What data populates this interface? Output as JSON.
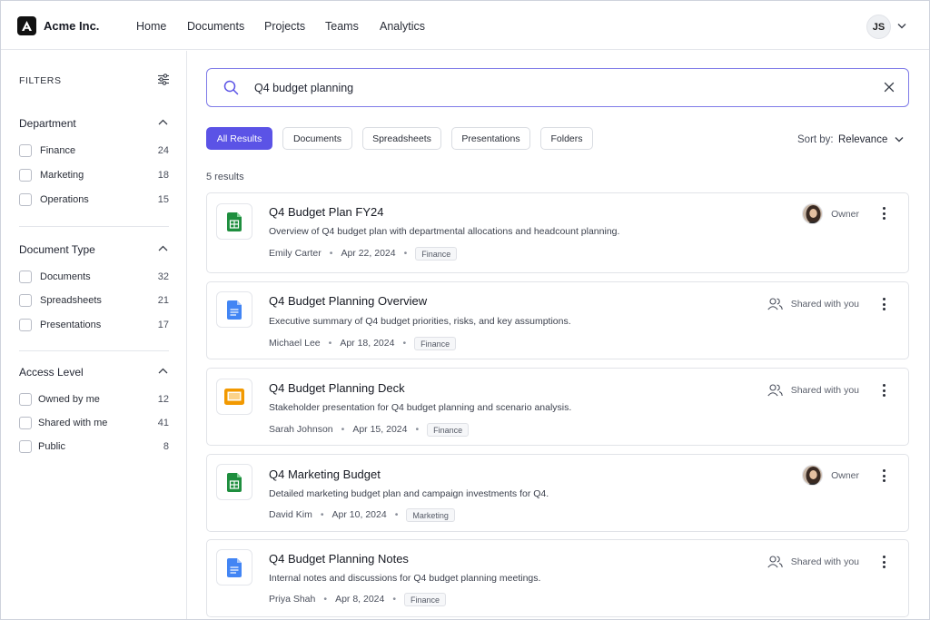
{
  "app": {
    "brand": "Acme Inc.",
    "nav": [
      "Home",
      "Documents",
      "Projects",
      "Teams",
      "Analytics"
    ],
    "user_initials": "JS"
  },
  "sidebar": {
    "title": "FILTERS",
    "sections": [
      {
        "title": "Department",
        "items": [
          {
            "label": "Finance",
            "count": "24"
          },
          {
            "label": "Marketing",
            "count": "18"
          },
          {
            "label": "Operations",
            "count": "15"
          }
        ]
      },
      {
        "title": "Document Type",
        "items": [
          {
            "label": "Documents",
            "count": "32"
          },
          {
            "label": "Spreadsheets",
            "count": "21"
          },
          {
            "label": "Presentations",
            "count": "17"
          }
        ]
      },
      {
        "title": "Access Level",
        "items": [
          {
            "label": "Owned by me",
            "count": "12"
          },
          {
            "label": "Shared with me",
            "count": "41"
          },
          {
            "label": "Public",
            "count": "8"
          }
        ]
      }
    ]
  },
  "search": {
    "value": "Q4 budget planning"
  },
  "tabs": [
    "All Results",
    "Documents",
    "Spreadsheets",
    "Presentations",
    "Folders"
  ],
  "active_tab": "All Results",
  "sort": {
    "label": "Sort by:",
    "value": "Relevance"
  },
  "result_count": "5 results",
  "results": [
    {
      "title": "Q4 Budget Plan FY24",
      "description": "Overview of Q4 budget plan with departmental allocations and headcount planning.",
      "author": "Emily Carter",
      "date": "Apr 22, 2024",
      "tag": "Finance",
      "access": "Owner",
      "file_type": "sheets-icon"
    },
    {
      "title": "Q4 Budget Planning Overview",
      "description": "Executive summary of Q4 budget priorities, risks, and key assumptions.",
      "author": "Michael Lee",
      "date": "Apr 18, 2024",
      "tag": "Finance",
      "access": "Shared with you",
      "file_type": "docs-icon"
    },
    {
      "title": "Q4 Budget Planning Deck",
      "description": "Stakeholder presentation for Q4 budget planning and scenario analysis.",
      "author": "Sarah Johnson",
      "date": "Apr 15, 2024",
      "tag": "Finance",
      "access": "Shared with you",
      "file_type": "slides-icon"
    },
    {
      "title": "Q4 Marketing Budget",
      "description": "Detailed marketing budget plan and campaign investments for Q4.",
      "author": "David Kim",
      "date": "Apr 10, 2024",
      "tag": "Marketing",
      "access": "Owner",
      "file_type": "sheets-icon"
    },
    {
      "title": "Q4 Budget Planning Notes",
      "description": "Internal notes and discussions for Q4 budget planning meetings.",
      "author": "Priya Shah",
      "date": "Apr 8, 2024",
      "tag": "Finance",
      "access": "Shared with you",
      "file_type": "docs-icon"
    }
  ],
  "colors": {
    "accent": "#5b53e6",
    "sheets_green": "#1e8e3e",
    "docs_blue": "#4285f4",
    "slides_orange": "#f29900"
  }
}
